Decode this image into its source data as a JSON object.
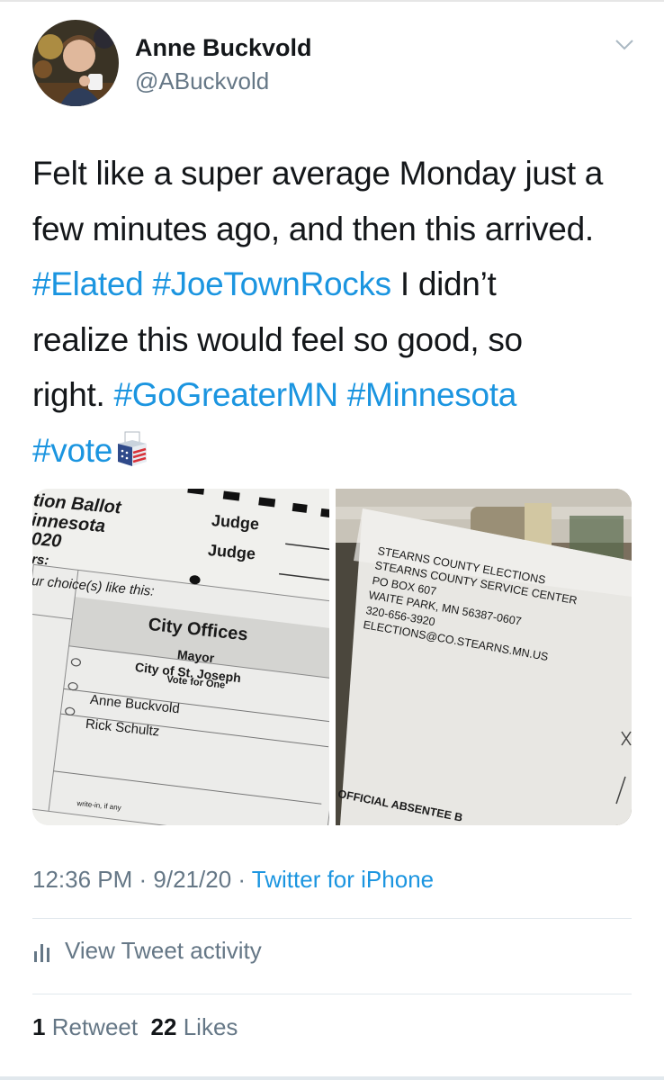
{
  "author": {
    "name": "Anne Buckvold",
    "handle": "@ABuckvold"
  },
  "tweet": {
    "line1": "Felt like a super average Monday just a",
    "line2": "few minutes ago, and then this arrived.",
    "line3_tags": "#Elated #JoeTownRocks",
    "line3_text": " I didn’t",
    "line4": "realize this would feel so good, so",
    "line5_text": "right. ",
    "line5_tags": "#GoGreaterMN #Minnesota",
    "line6_tag": "#vote",
    "emoji_icon": "ballot-box-icon"
  },
  "photos": {
    "left": {
      "header_line1": "tion Ballot",
      "header_line2": "innesota",
      "header_line3": "020",
      "judge1": "Judge",
      "judge2": "Judge",
      "rs": "rs:",
      "instruction": "ur choice(s) like this:",
      "section": "City Offices",
      "office": "Mayor",
      "city": "City of St. Joseph",
      "vote_for": "Vote for One",
      "candidate1": "Anne Buckvold",
      "candidate2": "Rick Schultz",
      "write_in": "write-in, if any"
    },
    "right": {
      "address": [
        "STEARNS COUNTY ELECTIONS",
        "STEARNS COUNTY SERVICE CENTER",
        "PO BOX 607",
        "WAITE PARK, MN 56387-0607",
        "320-656-3920",
        "ELECTIONS@CO.STEARNS.MN.US"
      ],
      "footer": "OFFICIAL ABSENTEE B"
    }
  },
  "meta": {
    "time": "12:36 PM",
    "sep": " · ",
    "date": "9/21/20",
    "source": "Twitter for iPhone"
  },
  "activity": {
    "label": "View Tweet activity"
  },
  "stats": {
    "retweets": "1",
    "retweets_label": "Retweet",
    "likes": "22",
    "likes_label": "Likes"
  },
  "colors": {
    "link": "#1b95e0",
    "secondary": "#657786",
    "text": "#14171a"
  }
}
